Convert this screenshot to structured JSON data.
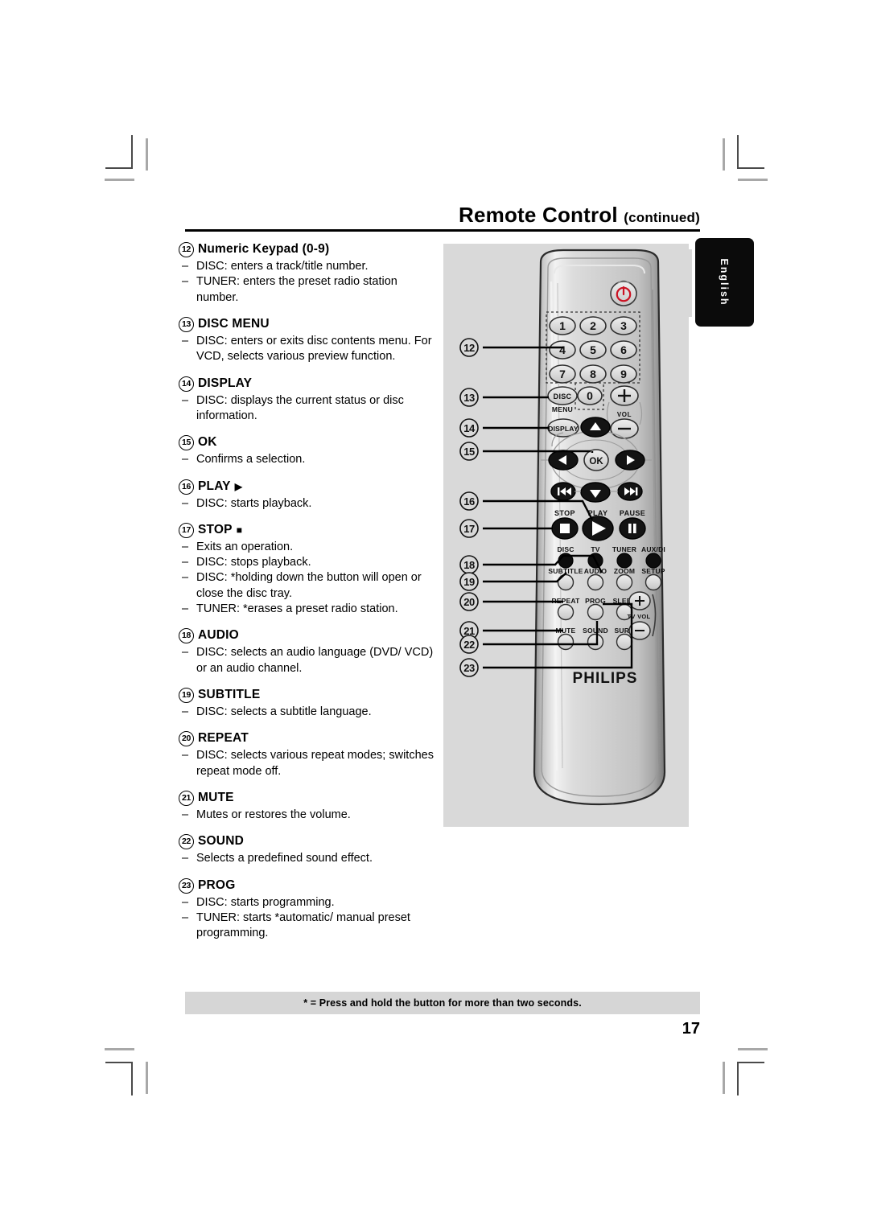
{
  "header": {
    "title": "Remote Control",
    "continued": "(continued)"
  },
  "language_tab": {
    "label": "English"
  },
  "specs": [
    {
      "num": "12",
      "label": "Numeric Keypad (0-9)",
      "glyph": "",
      "items": [
        "DISC: enters a track/title number.",
        "TUNER: enters the preset radio station number."
      ]
    },
    {
      "num": "13",
      "label": "DISC MENU",
      "glyph": "",
      "items": [
        "DISC: enters or exits disc contents menu. For VCD, selects various preview function."
      ]
    },
    {
      "num": "14",
      "label": "DISPLAY",
      "glyph": "",
      "items": [
        "DISC: displays the current status or disc information."
      ]
    },
    {
      "num": "15",
      "label": "OK",
      "glyph": "",
      "items": [
        "Confirms a selection."
      ]
    },
    {
      "num": "16",
      "label": "PLAY",
      "glyph": "▶",
      "items": [
        "DISC: starts playback."
      ]
    },
    {
      "num": "17",
      "label": "STOP",
      "glyph": "■",
      "items": [
        "Exits an operation.",
        "DISC: stops playback.",
        "DISC: *holding down the button will open or close the disc tray.",
        "TUNER: *erases a preset radio station."
      ]
    },
    {
      "num": "18",
      "label": "AUDIO",
      "glyph": "",
      "items": [
        "DISC: selects an audio language (DVD/ VCD) or an audio channel."
      ]
    },
    {
      "num": "19",
      "label": "SUBTITLE",
      "glyph": "",
      "items": [
        "DISC: selects a subtitle language."
      ]
    },
    {
      "num": "20",
      "label": "REPEAT",
      "glyph": "",
      "items": [
        "DISC: selects various repeat modes; switches repeat mode off."
      ]
    },
    {
      "num": "21",
      "label": "MUTE",
      "glyph": "",
      "items": [
        "Mutes or restores the volume."
      ]
    },
    {
      "num": "22",
      "label": "SOUND",
      "glyph": "",
      "items": [
        "Selects a predefined sound effect."
      ]
    },
    {
      "num": "23",
      "label": "PROG",
      "glyph": "",
      "items": [
        "DISC: starts programming.",
        "TUNER: starts *automatic/ manual preset programming."
      ]
    }
  ],
  "illustration": {
    "brand": "PHILIPS",
    "callouts": [
      "12",
      "13",
      "14",
      "15",
      "16",
      "17",
      "18",
      "19",
      "20",
      "21",
      "22",
      "23"
    ],
    "keypad": [
      "1",
      "2",
      "3",
      "4",
      "5",
      "6",
      "7",
      "8",
      "9",
      "0"
    ],
    "button_labels": {
      "disc_menu_top": "DISC",
      "disc_menu_bottom": "MENU",
      "display": "DISPLAY",
      "ok": "OK",
      "vol": "VOL",
      "vol_plus": "+",
      "vol_minus": "−",
      "stop": "STOP",
      "play": "PLAY",
      "pause": "PAUSE",
      "source_disc": "DISC",
      "source_tv": "TV",
      "source_tuner": "TUNER",
      "source_aux": "AUX/DI",
      "subtitle": "SUBTITLE",
      "audio": "AUDIO",
      "zoom": "ZOOM",
      "setup": "SETUP",
      "repeat": "REPEAT",
      "prog": "PROG",
      "sleep": "SLEEP",
      "mute": "MUTE",
      "sound": "SOUND",
      "surr": "SURR",
      "tv_vol": "TV VOL",
      "tv_vol_plus": "+",
      "tv_vol_minus": "−"
    }
  },
  "footnote": "* = Press and hold the button for more than two seconds.",
  "page_number": "17",
  "colors": {
    "panel_gray": "#d9d9d9",
    "footnote_gray": "#d6d6d6",
    "power_red": "#cc1122",
    "tab_black": "#0b0b0b"
  }
}
